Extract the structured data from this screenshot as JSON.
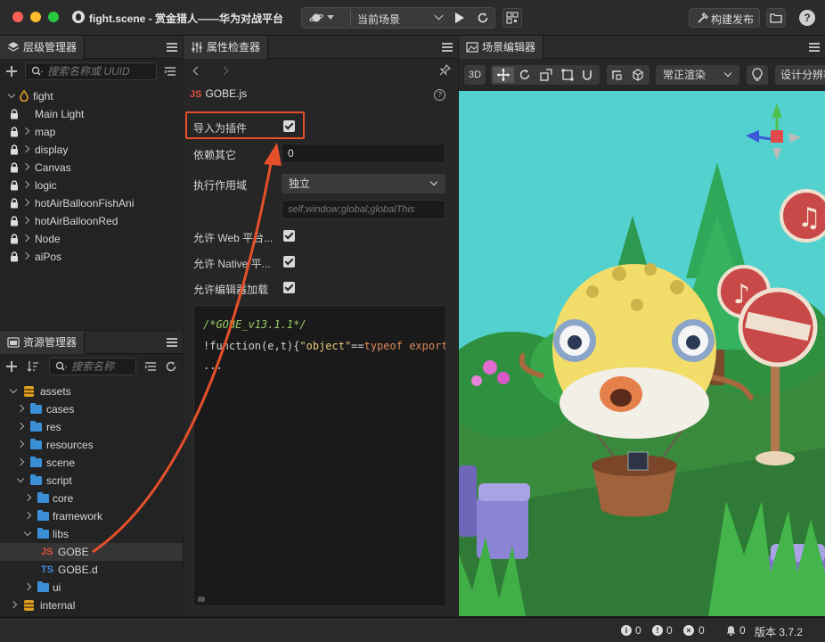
{
  "window": {
    "title": "fight.scene - 赏金猎人——华为对战平台"
  },
  "toolbar": {
    "current_scene": "当前场景",
    "build_label": "构建发布",
    "help": "?"
  },
  "hierarchy": {
    "tab": "层级管理器",
    "search_placeholder": "搜索名称或 UUID",
    "root": "fight",
    "items": [
      "Main Light",
      "map",
      "display",
      "Canvas",
      "logic",
      "hotAirBalloonFishAni",
      "hotAirBalloonRed",
      "Node",
      "aiPos"
    ]
  },
  "assets": {
    "tab": "资源管理器",
    "search_placeholder": "搜索名称",
    "root": "assets",
    "items": [
      "cases",
      "res",
      "resources",
      "scene",
      "script",
      "core",
      "framework",
      "libs",
      "GOBE",
      "GOBE.d",
      "ui",
      "internal"
    ],
    "js_tag": "JS",
    "ts_tag": "TS"
  },
  "inspector": {
    "tab": "属性检查器",
    "file_tag": "JS",
    "file_name": "GOBE.js",
    "help": "?",
    "props": {
      "import_plugin": "导入为插件",
      "depends": "依赖其它",
      "depends_value": "0",
      "scope": "执行作用域",
      "scope_value": "独立",
      "scope_placeholder": "self;window;global;globalThis",
      "allow_web": "允许 Web 平台...",
      "allow_native": "允许 Native 平...",
      "allow_editor": "允许编辑器加载"
    },
    "code": {
      "comment": "/*GOBE_v13.1.1*/",
      "p1": "!function(e,t){",
      "p2": "\"object\"",
      "p3": "==",
      "p4": "typeof",
      "p5": " export",
      "ellipsis": "..."
    }
  },
  "scene_editor": {
    "tab": "场景编辑器",
    "mode_3d": "3D",
    "render_mode": "常正渲染",
    "design_resolution": "设计分辨率"
  },
  "statusbar": {
    "info_count": "0",
    "warn_count": "0",
    "error_count": "0",
    "notify_count": "0",
    "version": "版本 3.7.2"
  },
  "colors": {
    "accent_red": "#e5502b",
    "folder_blue": "#3b8fd6",
    "js_red": "#e0523c",
    "ts_blue": "#3c8ce0",
    "sky": "#53d1cf"
  }
}
